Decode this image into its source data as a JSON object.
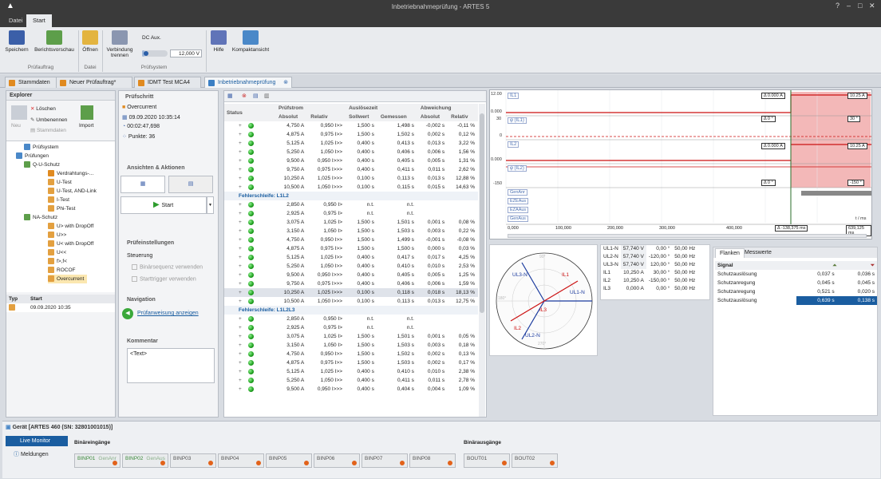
{
  "app": {
    "title": "Inbetriebnahmeprüfung - ARTES 5",
    "menu_tabs": [
      "Datei",
      "Start"
    ]
  },
  "ribbon": {
    "buttons": {
      "speichern": "Speichern",
      "berichtsvorschau": "Berichtsvorschau",
      "oeffnen": "Öffnen",
      "verbindung": "Verbindung trennen",
      "hilfe": "Hilfe",
      "kompaktansicht": "Kompaktansicht"
    },
    "dc_aux_label": "DC Aux.",
    "dc_aux_value": "12,000 V",
    "dc_aux_level": 0.1,
    "groups": {
      "pruefauftrag": "Prüfauftrag",
      "datei": "Datei",
      "pruefsystem": "Prüfsystem"
    }
  },
  "doc_tabs": [
    "Stammdaten",
    "Neuer Prüfauftrag*",
    "IDMT Test MCA4",
    "Inbetriebnahmeprüfung"
  ],
  "explorer": {
    "title": "Explorer",
    "actions": {
      "loeschen": "Löschen",
      "umbenennen": "Umbenennen",
      "stammdaten": "Stammdaten",
      "neu": "Neu",
      "import": "Import"
    },
    "tree": [
      "Prüfsystem",
      "Prüfungen",
      "Q-U-Schutz",
      "Verdrahtungs-...",
      "U-Test",
      "U-Test, AND-Link",
      "I-Test",
      "Phi-Test",
      "NA-Schutz",
      "U> with DropOff",
      "U>>",
      "U< with DropOff",
      "U<<",
      "f>,f<",
      "ROCOF",
      "Overcurrent"
    ],
    "table": {
      "headers": [
        "Typ",
        "Start"
      ],
      "row": "09.09.2020 10:35"
    }
  },
  "pruefschritt": {
    "title": "Prüfschritt",
    "name": "Overcurrent",
    "date": "09.09.2020 10:35:14",
    "duration": "00:02:47,698",
    "points": "Punkte: 36",
    "ansichten_title": "Ansichten & Aktionen",
    "start_btn": "Start",
    "einstellungen_title": "Prüfeinstellungen",
    "steuerung": "Steuerung",
    "binaer": "Binärsequenz verwenden",
    "starttrigger": "Starttrigger verwenden",
    "navigation_title": "Navigation",
    "navigation_link": "Prüfanweisung anzeigen",
    "kommentar_title": "Kommentar",
    "kommentar_text": "<Text>"
  },
  "grid": {
    "header_groups": [
      "Prüfstrom",
      "Auslösezeit",
      "Abweichung"
    ],
    "headers": [
      "Status",
      "Absolut",
      "Relativ",
      "Sollwert",
      "Gemessen",
      "Absolut",
      "Relativ"
    ],
    "sections": [
      {
        "title": "",
        "rows": [
          [
            "4,750 A",
            "0,950 I>>",
            "1,500 s",
            "1,498 s",
            "-0,002 s",
            "-0,11 %"
          ],
          [
            "4,875 A",
            "0,975 I>>",
            "1,500 s",
            "1,502 s",
            "0,002 s",
            "0,12 %"
          ],
          [
            "5,125 A",
            "1,025 I>>",
            "0,400 s",
            "0,413 s",
            "0,013 s",
            "3,22 %"
          ],
          [
            "5,250 A",
            "1,050 I>>",
            "0,400 s",
            "0,406 s",
            "0,006 s",
            "1,56 %"
          ],
          [
            "9,500 A",
            "0,950 I>>>",
            "0,400 s",
            "0,405 s",
            "0,005 s",
            "1,31 %"
          ],
          [
            "9,750 A",
            "0,975 I>>>",
            "0,400 s",
            "0,411 s",
            "0,011 s",
            "2,62 %"
          ],
          [
            "10,250 A",
            "1,025 I>>>",
            "0,100 s",
            "0,113 s",
            "0,013 s",
            "12,88 %"
          ],
          [
            "10,500 A",
            "1,050 I>>>",
            "0,100 s",
            "0,115 s",
            "0,015 s",
            "14,63 %"
          ]
        ]
      },
      {
        "title": "Fehlerschleife: L1L2",
        "rows": [
          [
            "2,850 A",
            "0,950 I>",
            "n.t.",
            "n.t.",
            "",
            ""
          ],
          [
            "2,925 A",
            "0,975 I>",
            "n.t.",
            "n.t.",
            "",
            ""
          ],
          [
            "3,075 A",
            "1,025 I>",
            "1,500 s",
            "1,501 s",
            "0,001 s",
            "0,08 %"
          ],
          [
            "3,150 A",
            "1,050 I>",
            "1,500 s",
            "1,503 s",
            "0,003 s",
            "0,22 %"
          ],
          [
            "4,750 A",
            "0,950 I>>",
            "1,500 s",
            "1,499 s",
            "-0,001 s",
            "-0,08 %"
          ],
          [
            "4,875 A",
            "0,975 I>>",
            "1,500 s",
            "1,500 s",
            "0,000 s",
            "0,03 %"
          ],
          [
            "5,125 A",
            "1,025 I>>",
            "0,400 s",
            "0,417 s",
            "0,017 s",
            "4,25 %"
          ],
          [
            "5,250 A",
            "1,050 I>>",
            "0,400 s",
            "0,410 s",
            "0,010 s",
            "2,53 %"
          ],
          [
            "9,500 A",
            "0,950 I>>>",
            "0,400 s",
            "0,405 s",
            "0,005 s",
            "1,25 %"
          ],
          [
            "9,750 A",
            "0,975 I>>>",
            "0,400 s",
            "0,406 s",
            "0,006 s",
            "1,59 %"
          ],
          [
            "10,250 A",
            "1,025 I>>>",
            "0,100 s",
            "0,118 s",
            "0,018 s",
            "18,13 %"
          ],
          [
            "10,500 A",
            "1,050 I>>>",
            "0,100 s",
            "0,113 s",
            "0,013 s",
            "12,75 %"
          ]
        ]
      },
      {
        "title": "Fehlerschleife: L1L2L3",
        "rows": [
          [
            "2,850 A",
            "0,950 I>",
            "n.t.",
            "n.t.",
            "",
            ""
          ],
          [
            "2,925 A",
            "0,975 I>",
            "n.t.",
            "n.t.",
            "",
            ""
          ],
          [
            "3,075 A",
            "1,025 I>",
            "1,500 s",
            "1,501 s",
            "0,001 s",
            "0,05 %"
          ],
          [
            "3,150 A",
            "1,050 I>",
            "1,500 s",
            "1,503 s",
            "0,003 s",
            "0,18 %"
          ],
          [
            "4,750 A",
            "0,950 I>>",
            "1,500 s",
            "1,502 s",
            "0,002 s",
            "0,13 %"
          ],
          [
            "4,875 A",
            "0,975 I>>",
            "1,500 s",
            "1,503 s",
            "0,002 s",
            "0,17 %"
          ],
          [
            "5,125 A",
            "1,025 I>>",
            "0,400 s",
            "0,410 s",
            "0,010 s",
            "2,38 %"
          ],
          [
            "5,250 A",
            "1,050 I>>",
            "0,400 s",
            "0,411 s",
            "0,011 s",
            "2,78 %"
          ],
          [
            "9,500 A",
            "0,950 I>>>",
            "0,400 s",
            "0,404 s",
            "0,004 s",
            "1,09 %"
          ]
        ]
      }
    ]
  },
  "oscillo": {
    "channels": [
      "IL1",
      "φ (IL1)",
      "IL2",
      "φ (IL2)"
    ],
    "y_ticks": [
      "12.00",
      "0.000",
      "30",
      "0",
      "0.000",
      "-150"
    ],
    "markers": [
      "Δ 0.000 A",
      "10.25 A",
      "Δ 0 °",
      "30 °",
      "Δ 0.000 A",
      "10.25 A",
      "Δ 0 °",
      "-150 °"
    ],
    "binary": [
      "GenAnr",
      "EZEAus",
      "EZAAus",
      "GenAus"
    ],
    "x_ticks": [
      "0,000",
      "100,000",
      "200,000",
      "300,000",
      "400,000"
    ],
    "cursor_label": "Δ -138,375 ms",
    "end_label": "639,125 ms",
    "unit": "t / ms"
  },
  "phasor": {
    "labels": [
      "UL1-N",
      "UL2-N",
      "UL3-N",
      "IL1",
      "IL2",
      "IL3"
    ],
    "scale": [
      "90°",
      "180°",
      "270°"
    ]
  },
  "values_table": [
    [
      "UL1-N",
      "57,740 V",
      "0,00 °",
      "50,00 Hz"
    ],
    [
      "UL2-N",
      "57,740 V",
      "-120,00 °",
      "50,00 Hz"
    ],
    [
      "UL3-N",
      "57,740 V",
      "120,00 °",
      "50,00 Hz"
    ],
    [
      "IL1",
      "10,250 A",
      "30,00 °",
      "50,00 Hz"
    ],
    [
      "IL2",
      "10,250 A",
      "-150,00 °",
      "50,00 Hz"
    ],
    [
      "IL3",
      "0,000 A",
      "0,00 °",
      "50,00 Hz"
    ]
  ],
  "flanken": {
    "tabs": [
      "Flanken",
      "Messwerte"
    ],
    "header": "Signal",
    "rows": [
      [
        "Schutzauslösung",
        "0,037 s",
        "0,036 s"
      ],
      [
        "Schutzanregung",
        "0,045 s",
        "0,045 s"
      ],
      [
        "Schutzanregung",
        "0,521 s",
        "0,020 s"
      ],
      [
        "Schutzauslösung",
        "0,639 s",
        "0,138 s"
      ]
    ]
  },
  "device": {
    "title": "Gerät [ARTES 460 (SN: 32801001015)]",
    "nav": [
      "Live Monitor",
      "Meldungen"
    ],
    "binaereingaenge": "Binäreingänge",
    "binaerausgaenge": "Binärausgänge",
    "inputs": [
      {
        "name": "BINP01",
        "sub": "GenAnr"
      },
      {
        "name": "BINP02",
        "sub": "GenAus"
      },
      {
        "name": "BINP03",
        "sub": ""
      },
      {
        "name": "BINP04",
        "sub": ""
      },
      {
        "name": "BINP05",
        "sub": ""
      },
      {
        "name": "BINP06",
        "sub": ""
      },
      {
        "name": "BINP07",
        "sub": ""
      },
      {
        "name": "BINP08",
        "sub": ""
      }
    ],
    "outputs": [
      "BOUT01",
      "BOUT02"
    ]
  }
}
